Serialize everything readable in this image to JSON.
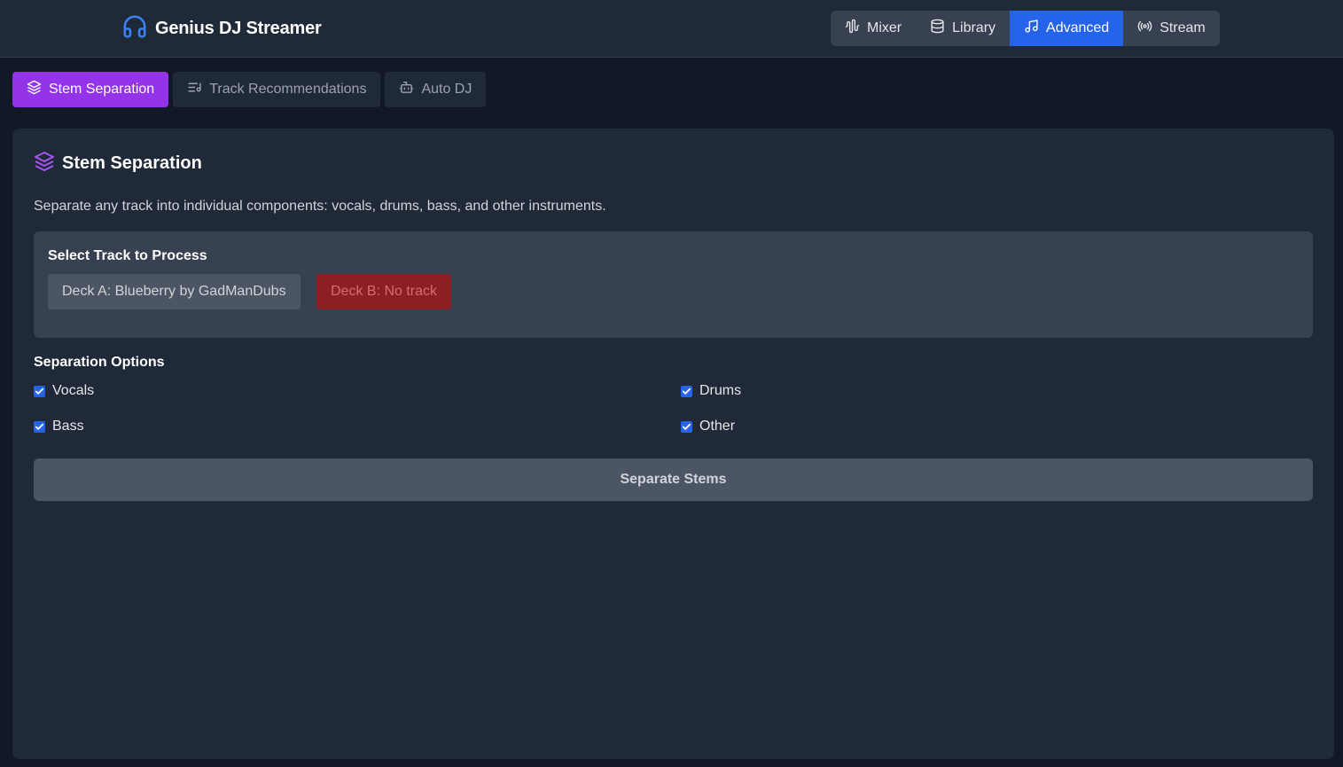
{
  "app": {
    "title": "Genius DJ Streamer",
    "icon": "headphones-icon",
    "accent": "#3b82f6"
  },
  "nav": {
    "items": [
      {
        "label": "Mixer",
        "icon": "audio-waveform-icon",
        "active": false
      },
      {
        "label": "Library",
        "icon": "database-icon",
        "active": false
      },
      {
        "label": "Advanced",
        "icon": "music-note-icon",
        "active": true
      },
      {
        "label": "Stream",
        "icon": "radio-broadcast-icon",
        "active": false
      }
    ],
    "active_color": "#2563eb"
  },
  "subtabs": {
    "items": [
      {
        "label": "Stem Separation",
        "icon": "layers-icon",
        "active": true
      },
      {
        "label": "Track Recommendations",
        "icon": "list-music-icon",
        "active": false
      },
      {
        "label": "Auto DJ",
        "icon": "bot-icon",
        "active": false
      }
    ],
    "active_color": "#9333ea"
  },
  "panel": {
    "title": "Stem Separation",
    "icon": "layers-icon",
    "description": "Separate any track into individual components: vocals, drums, bass, and other instruments.",
    "select": {
      "title": "Select Track to Process",
      "deck_a": "Deck A: Blueberry by GadManDubs",
      "deck_b": "Deck B: No track"
    },
    "options": {
      "title": "Separation Options",
      "items": [
        {
          "label": "Vocals",
          "checked": true
        },
        {
          "label": "Drums",
          "checked": true
        },
        {
          "label": "Bass",
          "checked": true
        },
        {
          "label": "Other",
          "checked": true
        }
      ]
    },
    "action_label": "Separate Stems"
  }
}
